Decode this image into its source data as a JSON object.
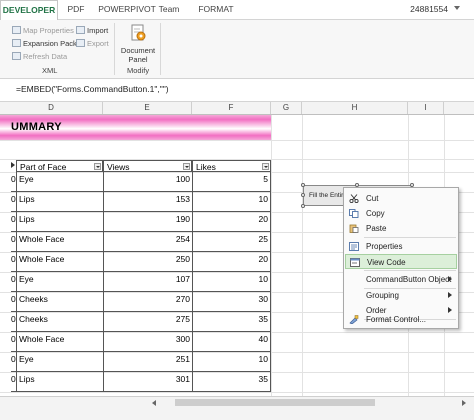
{
  "ribbon": {
    "tabs": [
      "DEVELOPER",
      "PDF",
      "POWERPIVOT",
      "Team",
      "FORMAT"
    ],
    "active_tab": "DEVELOPER",
    "account": "24881554",
    "xml_items": [
      "Map Properties",
      "Expansion Packs",
      "Refresh Data",
      "Import",
      "Export"
    ],
    "xml_group_label": "XML",
    "document_panel": [
      "Document",
      "Panel"
    ],
    "modify_group_label": "Modify"
  },
  "formula_bar": {
    "value": "=EMBED(\"Forms.CommandButton.1\",\"\")"
  },
  "columns": [
    "D",
    "E",
    "F",
    "G",
    "H",
    "I"
  ],
  "sheet": {
    "banner_title": "UMMARY",
    "headers": [
      "Part of Face",
      "Views",
      "Likes"
    ],
    "rows": [
      {
        "idx": "0",
        "face": "Eye",
        "views": "100",
        "likes": "5"
      },
      {
        "idx": "0",
        "face": "Lips",
        "views": "153",
        "likes": "10"
      },
      {
        "idx": "0",
        "face": "Lips",
        "views": "190",
        "likes": "20"
      },
      {
        "idx": "0",
        "face": "Whole Face",
        "views": "254",
        "likes": "25"
      },
      {
        "idx": "0",
        "face": "Whole Face",
        "views": "250",
        "likes": "20"
      },
      {
        "idx": "0",
        "face": "Eye",
        "views": "107",
        "likes": "10"
      },
      {
        "idx": "0",
        "face": "Cheeks",
        "views": "270",
        "likes": "30"
      },
      {
        "idx": "0",
        "face": "Cheeks",
        "views": "275",
        "likes": "35"
      },
      {
        "idx": "0",
        "face": "Whole Face",
        "views": "300",
        "likes": "40"
      },
      {
        "idx": "0",
        "face": "Eye",
        "views": "251",
        "likes": "10"
      },
      {
        "idx": "0",
        "face": "Lips",
        "views": "301",
        "likes": "35"
      }
    ]
  },
  "command_button": {
    "caption": "Fill the Entir"
  },
  "context_menu": {
    "items": [
      "Cut",
      "Copy",
      "Paste",
      "Properties",
      "View Code",
      "CommandButton Object",
      "Grouping",
      "Order",
      "Format Control..."
    ],
    "highlighted": "View Code"
  },
  "colors": {
    "accent": "#217346",
    "banner_pink": "#f26fc2",
    "menu_highlight": "#dcefd9"
  }
}
